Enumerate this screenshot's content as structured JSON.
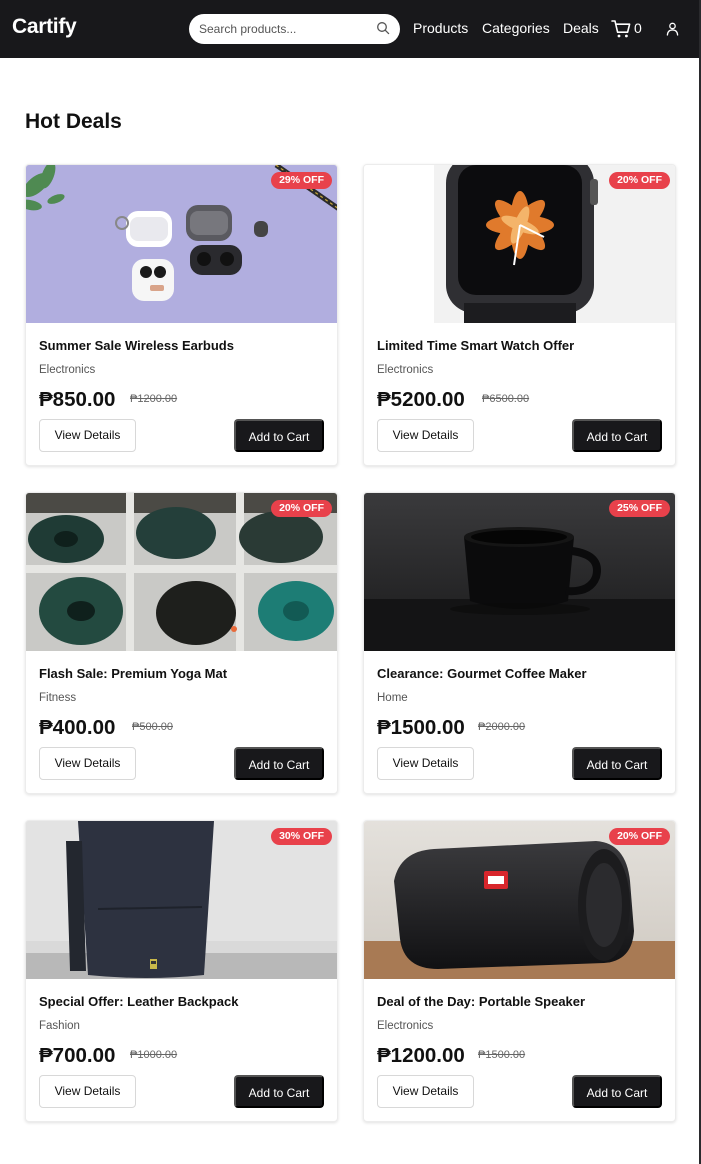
{
  "header": {
    "brand": "Cartify",
    "search_placeholder": "Search products...",
    "nav": [
      "Products",
      "Categories",
      "Deals"
    ],
    "cart_count": "0"
  },
  "section_title": "Hot Deals",
  "buttons": {
    "view_details": "View Details",
    "add_to_cart": "Add to Cart"
  },
  "colors": {
    "header_bg": "#18181b",
    "badge": "#e8414b",
    "primary_button": "#18181b"
  },
  "deals": [
    {
      "title": "Summer Sale Wireless Earbuds",
      "category": "Electronics",
      "price": "₱850.00",
      "original_price": "₱1200.00",
      "discount": "29% OFF",
      "image": "wireless earbuds and cases on lavender background"
    },
    {
      "title": "Limited Time Smart Watch Offer",
      "category": "Electronics",
      "price": "₱5200.00",
      "original_price": "₱6500.00",
      "discount": "20% OFF",
      "image": "smart watch with orange flower watch face"
    },
    {
      "title": "Flash Sale: Premium Yoga Mat",
      "category": "Fitness",
      "price": "₱400.00",
      "original_price": "₱500.00",
      "discount": "20% OFF",
      "image": "rolled yoga mats in cubby shelves"
    },
    {
      "title": "Clearance: Gourmet Coffee Maker",
      "category": "Home",
      "price": "₱1500.00",
      "original_price": "₱2000.00",
      "discount": "25% OFF",
      "image": "black coffee mug on dark table"
    },
    {
      "title": "Special Offer: Leather Backpack",
      "category": "Fashion",
      "price": "₱700.00",
      "original_price": "₱1000.00",
      "discount": "30% OFF",
      "image": "navy backpack against white wall"
    },
    {
      "title": "Deal of the Day: Portable Speaker",
      "category": "Electronics",
      "price": "₱1200.00",
      "original_price": "₱1500.00",
      "discount": "20% OFF",
      "image": "black cylindrical portable speaker on wooden table"
    }
  ]
}
